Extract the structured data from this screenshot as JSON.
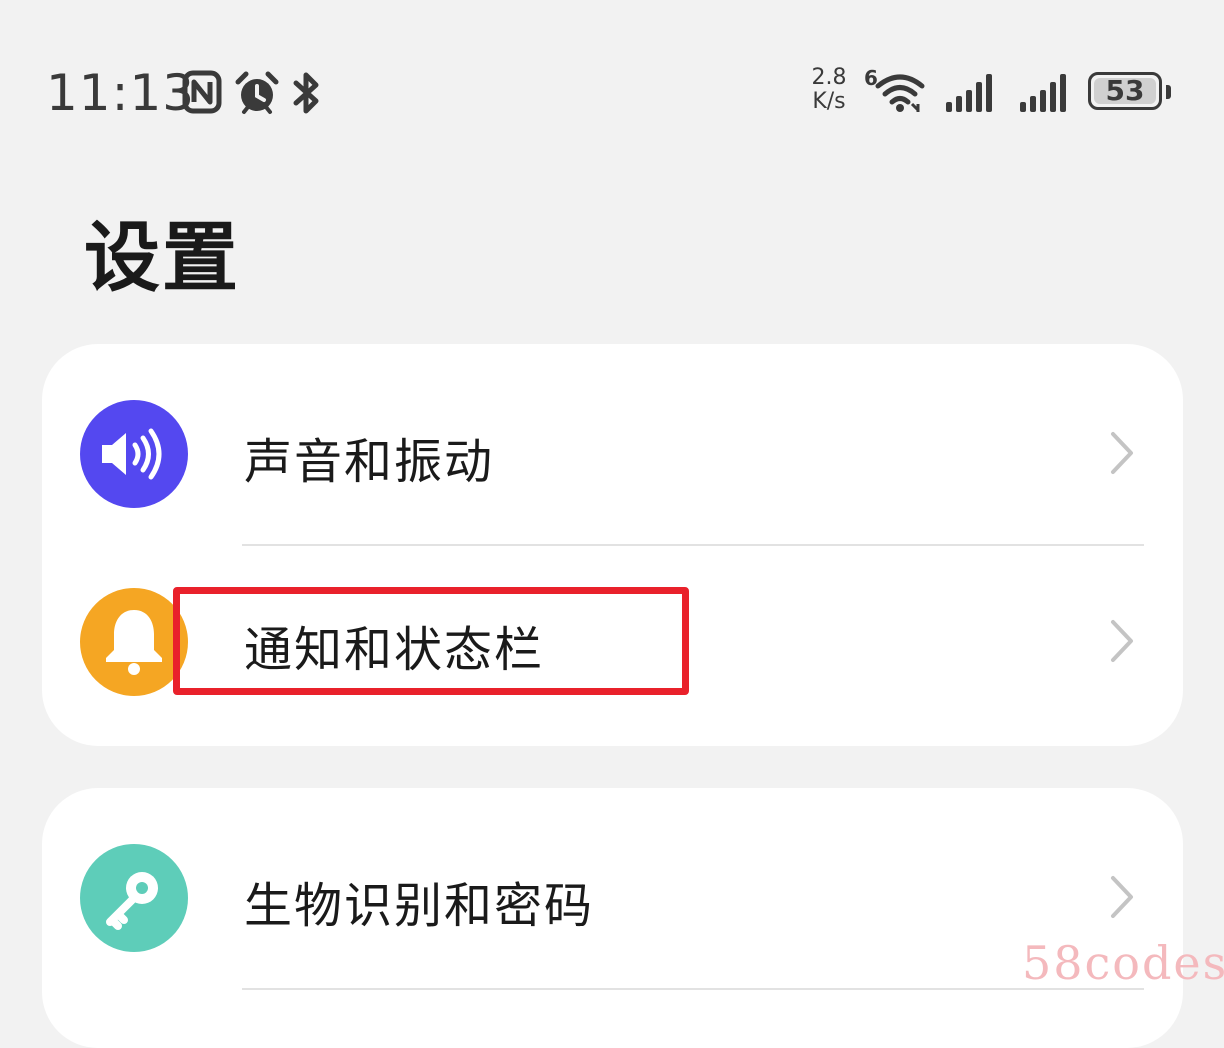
{
  "status_bar": {
    "time": "11:13",
    "icons": [
      "nfc-icon",
      "alarm-icon",
      "bluetooth-icon",
      "wifi-6-icon",
      "signal-icon",
      "signal-icon"
    ],
    "net_speed_value": "2.8",
    "net_speed_unit": "K/s",
    "wifi_badge": "6",
    "battery_level": "53"
  },
  "page": {
    "title": "设置"
  },
  "cards": [
    {
      "items": [
        {
          "label": "声音和振动",
          "icon": "speaker-icon",
          "icon_color": "#5448f0"
        },
        {
          "label": "通知和状态栏",
          "icon": "bell-icon",
          "icon_color": "#f5a623"
        }
      ]
    },
    {
      "items": [
        {
          "label": "生物识别和密码",
          "icon": "key-icon",
          "icon_color": "#5ecdb9"
        }
      ]
    }
  ],
  "annotation": {
    "highlight_color": "#e9212b"
  },
  "watermark": "58codes"
}
